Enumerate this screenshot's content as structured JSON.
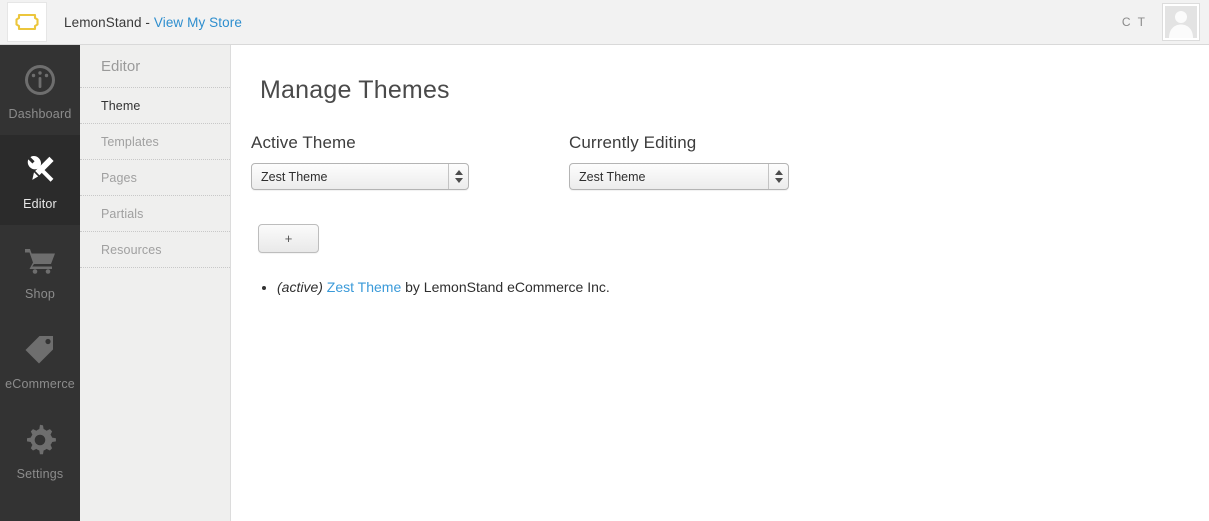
{
  "header": {
    "logo_icon": "lemon-outline-icon",
    "brand_prefix": "LemonStand - ",
    "view_store_link": "View My Store",
    "user_initials": "C T",
    "avatar_icon": "user-silhouette-icon"
  },
  "rail": {
    "items": [
      {
        "label": "Dashboard",
        "icon": "gauge-icon",
        "active": false
      },
      {
        "label": "Editor",
        "icon": "tools-icon",
        "active": true
      },
      {
        "label": "Shop",
        "icon": "cart-icon",
        "active": false
      },
      {
        "label": "eCommerce",
        "icon": "tag-icon",
        "active": false
      },
      {
        "label": "Settings",
        "icon": "gear-icon",
        "active": false
      }
    ]
  },
  "subnav": {
    "title": "Editor",
    "items": [
      {
        "label": "Theme",
        "active": true
      },
      {
        "label": "Templates",
        "active": false
      },
      {
        "label": "Pages",
        "active": false
      },
      {
        "label": "Partials",
        "active": false
      },
      {
        "label": "Resources",
        "active": false
      }
    ]
  },
  "main": {
    "page_title": "Manage Themes",
    "active_theme": {
      "label": "Active Theme",
      "selected": "Zest Theme"
    },
    "currently_editing": {
      "label": "Currently Editing",
      "selected": "Zest Theme"
    },
    "add_button_label": "+",
    "themes": [
      {
        "status": "(active)",
        "name": "Zest Theme",
        "author_text": " by LemonStand eCommerce Inc."
      }
    ]
  },
  "colors": {
    "rail_bg": "#333333",
    "rail_active_bg": "#2b2b2b",
    "subnav_bg": "#efefee",
    "link_blue": "#2e8ece",
    "theme_link_blue": "#3a9ad9",
    "logo_yellow": "#ecc63c",
    "topbar_bg": "#f2f2f2"
  }
}
